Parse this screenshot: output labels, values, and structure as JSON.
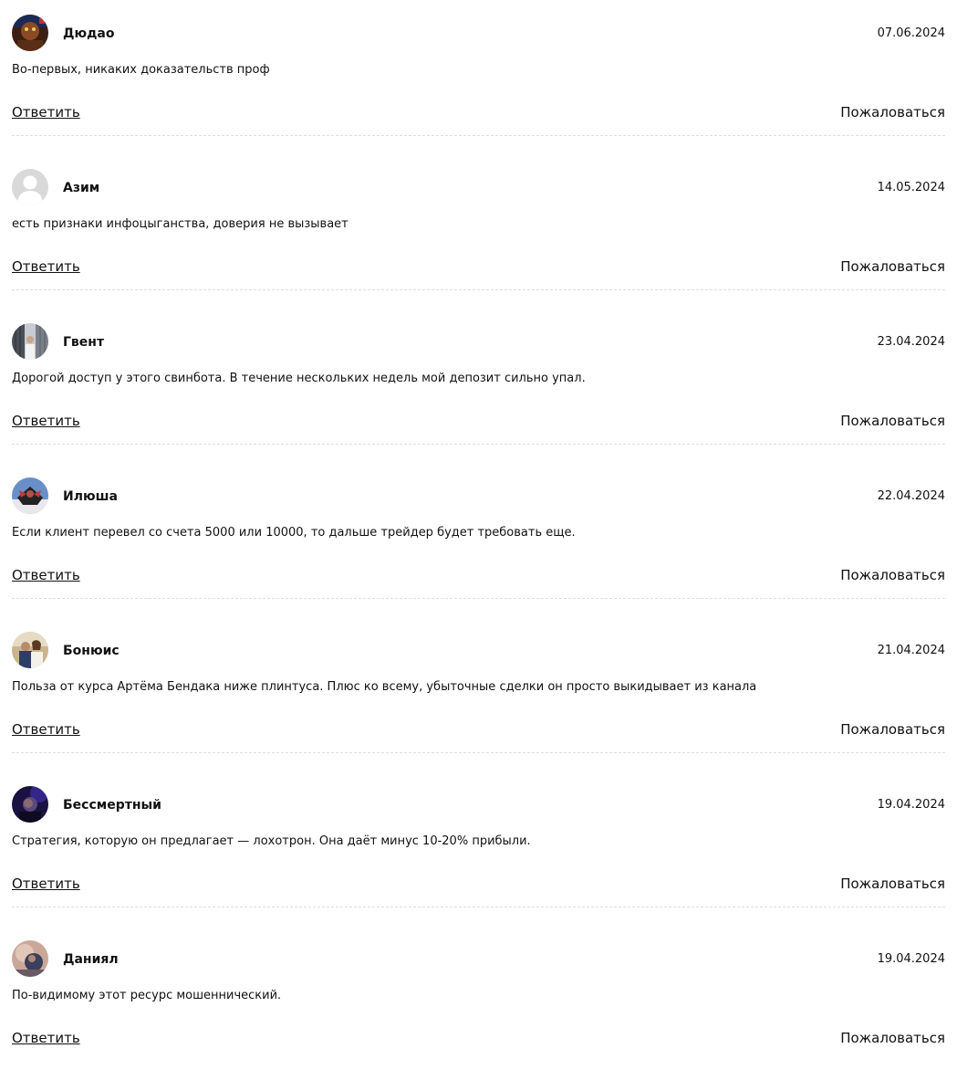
{
  "comments": [
    {
      "author": "Дюдао",
      "date": "07.06.2024",
      "text": "Во-первых, никаких доказательств проф",
      "reply_label": "Ответить",
      "complain_label": "Пожаловаться",
      "avatar": "photo-avatar"
    },
    {
      "author": "Азим",
      "date": "14.05.2024",
      "text": "есть признаки инфоцыганства, доверия не вызывает",
      "reply_label": "Ответить",
      "complain_label": "Пожаловаться",
      "avatar": "default-user-icon"
    },
    {
      "author": "Гвент",
      "date": "23.04.2024",
      "text": "Дорогой доступ у этого свинбота. В течение нескольких недель мой депозит сильно упал.",
      "reply_label": "Ответить",
      "complain_label": "Пожаловаться",
      "avatar": "photo-avatar"
    },
    {
      "author": "Илюша",
      "date": "22.04.2024",
      "text": "Если клиент перевел со счета 5000 или 10000, то дальше трейдер будет требовать еще.",
      "reply_label": "Ответить",
      "complain_label": "Пожаловаться",
      "avatar": "photo-avatar"
    },
    {
      "author": "Бонюис",
      "date": "21.04.2024",
      "text": "Польза от курса Артёма Бендака ниже плинтуса. Плюс ко всему, убыточные сделки он просто выкидывает из канала",
      "reply_label": "Ответить",
      "complain_label": "Пожаловаться",
      "avatar": "photo-avatar"
    },
    {
      "author": "Бессмертный",
      "date": "19.04.2024",
      "text": "Стратегия, которую он предлагает — лохотрон. Она даёт минус 10-20% прибыли.",
      "reply_label": "Ответить",
      "complain_label": "Пожаловаться",
      "avatar": "photo-avatar"
    },
    {
      "author": "Даниял",
      "date": "19.04.2024",
      "text": "По-видимому этот ресурс мошеннический.",
      "reply_label": "Ответить",
      "complain_label": "Пожаловаться",
      "avatar": "photo-avatar"
    }
  ],
  "colors": {
    "text": "#111111",
    "divider": "#dedede",
    "default_avatar_bg": "#d9d9d9"
  }
}
